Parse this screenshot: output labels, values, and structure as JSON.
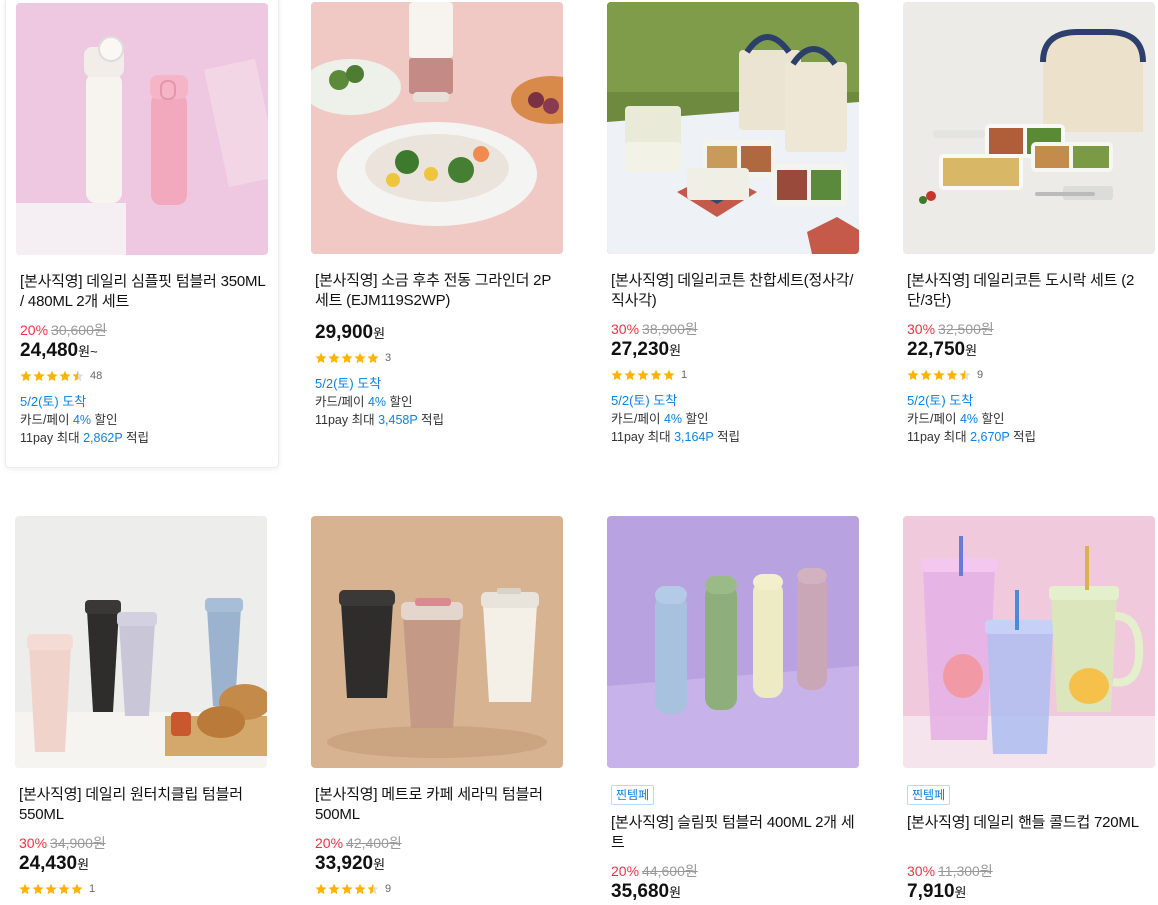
{
  "colors": {
    "discount": "#f43142",
    "blue": "#0b83e6",
    "star": "#ffb300"
  },
  "products": [
    {
      "title": "[본사직영] 데일리 심플핏 텀블러 350ML / 480ML 2개 세트",
      "discount": "20%",
      "original_price": "30,600원",
      "price": "24,480",
      "unit": "원~",
      "rating": 4.5,
      "review_count": "48",
      "delivery": "5/2(토) 도착",
      "card_pre": "카드/페이 ",
      "card_pct": "4%",
      "card_post": " 할인",
      "pay_pre": "11pay 최대 ",
      "pay_points": "2,862P",
      "pay_post": " 적립",
      "image_icon": "tumbler-photo"
    },
    {
      "title": "[본사직영] 소금 후추 전동 그라인더 2P 세트 (EJM119S2WP)",
      "discount": "",
      "original_price": "",
      "price": "29,900",
      "unit": "원",
      "rating": 5,
      "review_count": "3",
      "delivery": "5/2(토) 도착",
      "card_pre": "카드/페이 ",
      "card_pct": "4%",
      "card_post": " 할인",
      "pay_pre": "11pay 최대 ",
      "pay_points": "3,458P",
      "pay_post": " 적립",
      "image_icon": "grinder-photo"
    },
    {
      "title": "[본사직영] 데일리코튼 찬합세트(정사각/직사각)",
      "discount": "30%",
      "original_price": "38,900원",
      "price": "27,230",
      "unit": "원",
      "rating": 5,
      "review_count": "1",
      "delivery": "5/2(토) 도착",
      "card_pre": "카드/페이 ",
      "card_pct": "4%",
      "card_post": " 할인",
      "pay_pre": "11pay 최대 ",
      "pay_points": "3,164P",
      "pay_post": " 적립",
      "image_icon": "container-set-photo"
    },
    {
      "title": "[본사직영] 데일리코튼 도시락 세트 (2단/3단)",
      "discount": "30%",
      "original_price": "32,500원",
      "price": "22,750",
      "unit": "원",
      "rating": 4.5,
      "review_count": "9",
      "delivery": "5/2(토) 도착",
      "card_pre": "카드/페이 ",
      "card_pct": "4%",
      "card_post": " 할인",
      "pay_pre": "11pay 최대 ",
      "pay_points": "2,670P",
      "pay_post": " 적립",
      "image_icon": "lunchbox-photo"
    },
    {
      "title": "[본사직영] 데일리 원터치클립 텀블러 550ML",
      "discount": "30%",
      "original_price": "34,900원",
      "price": "24,430",
      "unit": "원",
      "rating": 5,
      "review_count": "1",
      "image_icon": "tumbler-set-photo"
    },
    {
      "title": "[본사직영] 메트로 카페 세라믹 텀블러 500ML",
      "discount": "20%",
      "original_price": "42,400원",
      "price": "33,920",
      "unit": "원",
      "rating": 4.5,
      "review_count": "9",
      "image_icon": "ceramic-tumbler-photo"
    },
    {
      "badge": "찐템페",
      "title": "[본사직영] 슬림핏 텀블러 400ML 2개 세트",
      "discount": "20%",
      "original_price": "44,600원",
      "price": "35,680",
      "unit": "원",
      "image_icon": "slim-tumbler-photo"
    },
    {
      "badge": "찐템페",
      "title": "[본사직영] 데일리 핸들 콜드컵 720ML",
      "discount": "30%",
      "original_price": "11,300원",
      "price": "7,910",
      "unit": "원",
      "image_icon": "cold-cup-photo"
    }
  ]
}
